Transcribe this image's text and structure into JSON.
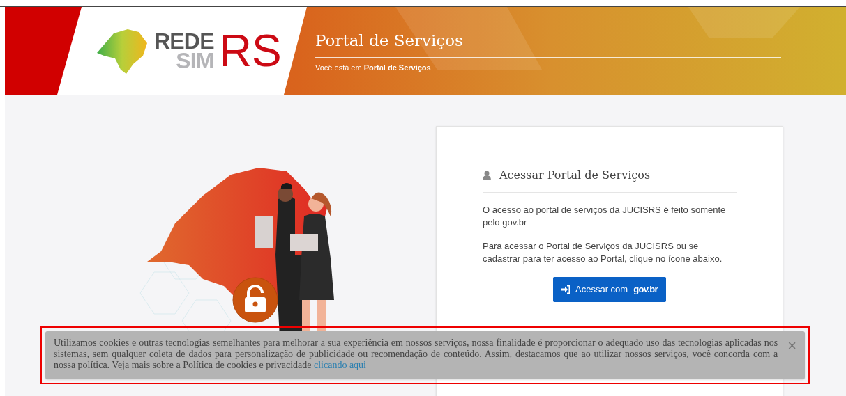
{
  "header": {
    "logo": {
      "line_1": "REDE",
      "line_2": "SIM",
      "mark": "RS"
    },
    "title": "Portal de Serviços",
    "breadcrumb": {
      "prefix": "Você está em",
      "current": "Portal de Serviços"
    }
  },
  "login_card": {
    "title": "Acessar Portal de Serviços",
    "paragraphs": [
      "O acesso ao portal de serviços da JUCISRS é feito somente pelo gov.br",
      "Para acessar o Portal de Serviços da JUCISRS ou se cadastrar para ter acesso ao Portal, clique no ícone abaixo."
    ],
    "button": {
      "label": "Acessar com",
      "brand": "gov.br"
    }
  },
  "cookie_banner": {
    "text": "Utilizamos cookies e outras tecnologias semelhantes para melhorar a sua experiência em nossos serviços, nossa finalidade é proporcionar o adequado uso das tecnologias aplicadas nos sistemas, sem qualquer coleta de dados para personalização de publicidade ou recomendação de conteúdo. Assim, destacamos que ao utilizar nossos serviços, você concorda com a nossa política. Veja mais sobre a Política de cookies e privacidade",
    "link": "clicando aqui",
    "close": "×"
  }
}
